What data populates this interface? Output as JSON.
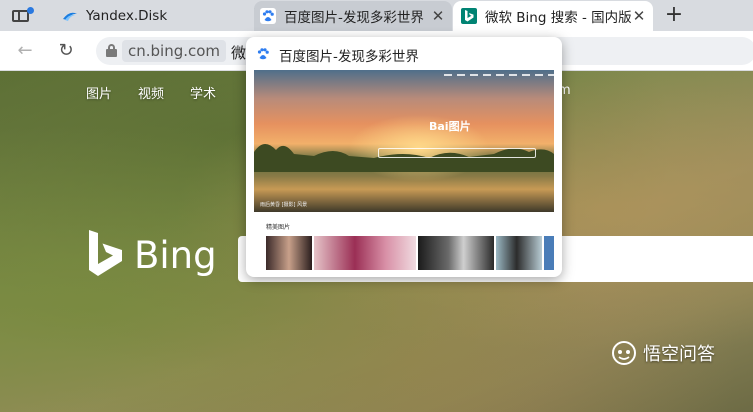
{
  "browser": {
    "tabs": [
      {
        "title": "Yandex.Disk",
        "favicon": "yandex-disk-icon",
        "state": "normal"
      },
      {
        "title": "百度图片-发现多彩世界",
        "favicon": "baidu-paw-icon",
        "state": "hovered",
        "close": "✕"
      },
      {
        "title": "微软 Bing 搜索 - 国内版",
        "favicon": "bing-icon",
        "state": "active",
        "close": "✕"
      }
    ],
    "new_tab": "+",
    "toolbar": {
      "back": "←",
      "reload": "↻",
      "url_host": "cn.bing.com",
      "url_rest": "微"
    }
  },
  "page": {
    "nav": [
      "图片",
      "视频",
      "学术"
    ],
    "nav_extra": "m",
    "logo_text": "Bing",
    "watermark": "悟空问答"
  },
  "hovercard": {
    "title": "百度图片-发现多彩世界",
    "preview": {
      "logo": "Bai",
      "logo_accent": "图片",
      "caption": "雨后黄昏 [摄影] 风景",
      "section_label": "精美图片"
    }
  },
  "colors": {
    "tabstrip": "#d8dbe0",
    "active_tab": "#ffffff",
    "bing_teal": "#008373",
    "baidu_blue": "#2e7df0"
  }
}
